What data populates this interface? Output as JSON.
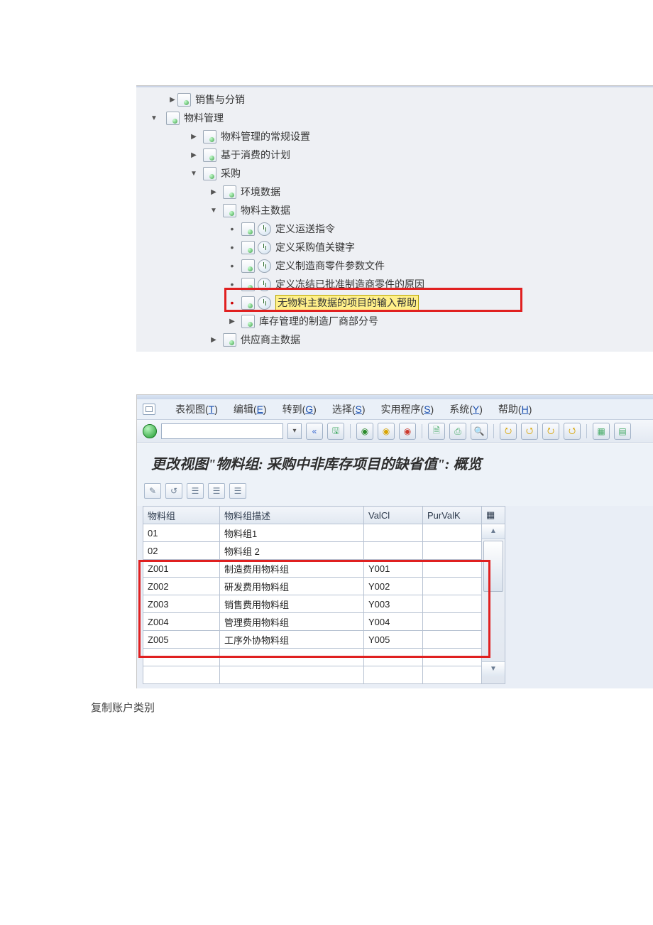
{
  "tree": {
    "n0": "销售与分销",
    "n1": "物料管理",
    "n2": "物料管理的常规设置",
    "n3": "基于消费的计划",
    "n4": "采购",
    "n5": "环境数据",
    "n6": "物料主数据",
    "n7": "定义运送指令",
    "n8": "定义采购值关键字",
    "n9": "定义制造商零件参数文件",
    "n10": "定义冻结已批准制造商零件的原因",
    "n11": "无物料主数据的项目的输入帮助",
    "n12": "库存管理的制造厂商部分号",
    "n13": "供应商主数据"
  },
  "menu": {
    "m1a": "表视图(",
    "m1k": "T",
    "m1b": ")",
    "m2a": "编辑(",
    "m2k": "E",
    "m2b": ")",
    "m3a": "转到(",
    "m3k": "G",
    "m3b": ")",
    "m4a": "选择(",
    "m4k": "S",
    "m4b": ")",
    "m5a": "实用程序(",
    "m5k": "S",
    "m5b": ")",
    "m6a": "系统(",
    "m6k": "Y",
    "m6b": ")",
    "m7a": "帮助(",
    "m7k": "H",
    "m7b": ")"
  },
  "toolbar": {
    "back_glyph": "«",
    "drop_glyph": "▾",
    "save_glyph": "🖫",
    "b1": "◉",
    "b2": "◉",
    "b3": "◉",
    "p1": "🗎",
    "p2": "⎙",
    "p3": "🔍",
    "n1": "⭮",
    "n2": "⭯",
    "n3": "⭮",
    "n4": "⭯",
    "w1": "▦",
    "w2": "▤"
  },
  "title2": "更改视图\"物料组: 采购中非库存项目的缺省值\":  概览",
  "appbar": {
    "a1": "✎",
    "a2": "↺",
    "a3": "☰",
    "a4": "☰",
    "a5": "☰"
  },
  "grid": {
    "h1": "物料组",
    "h2": "物料组描述",
    "h3": "ValCl",
    "h4": "PurValK",
    "cfg": "▦",
    "r1c1": "01",
    "r1c2": "物料组1",
    "r1c3": "",
    "r1c4": "",
    "r2c1": "02",
    "r2c2": "物料组 2",
    "r2c3": "",
    "r2c4": "",
    "r3c1": "Z001",
    "r3c2": "制造费用物料组",
    "r3c3": "Y001",
    "r3c4": "",
    "r4c1": "Z002",
    "r4c2": "研发费用物料组",
    "r4c3": "Y002",
    "r4c4": "",
    "r5c1": "Z003",
    "r5c2": "销售费用物料组",
    "r5c3": "Y003",
    "r5c4": "",
    "r6c1": "Z004",
    "r6c2": "管理费用物料组",
    "r6c3": "Y004",
    "r6c4": "",
    "r7c1": "Z005",
    "r7c2": "工序外协物料组",
    "r7c3": "Y005",
    "r7c4": ""
  },
  "scroll": {
    "up": "▲",
    "dn": "▼"
  },
  "caption": "复制账户类别"
}
